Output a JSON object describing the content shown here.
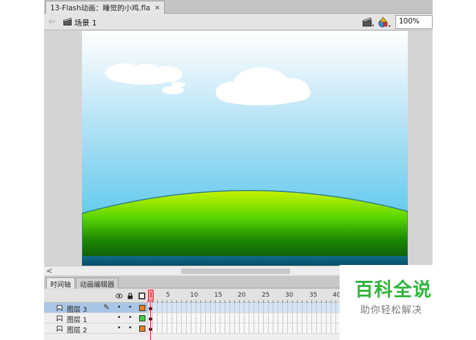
{
  "document": {
    "tab_title": "13-Flash动画：睡觉的小鸡.fla",
    "close_glyph": "×"
  },
  "edit_bar": {
    "back_glyph": "⇦",
    "scene_label": "场景 1",
    "zoom": "100%"
  },
  "scrollbar": {
    "left_arrow": "<"
  },
  "panel_tabs": {
    "timeline": "时间轴",
    "motion_editor": "动画编辑器"
  },
  "timeline": {
    "playhead_frame": "1",
    "ruler_labels": [
      "5",
      "10",
      "15",
      "20",
      "25",
      "30",
      "35",
      "40"
    ],
    "layers": [
      {
        "name": "图层 3",
        "selected": true,
        "editing": true,
        "color": "#ee7d1a"
      },
      {
        "name": "图层 1",
        "selected": false,
        "editing": false,
        "color": "#44cc44"
      },
      {
        "name": "图层 2",
        "selected": false,
        "editing": false,
        "color": "#ee7d1a"
      }
    ],
    "visible_dot": "•",
    "pencil_glyph": "✎"
  },
  "watermark": {
    "title": "百科全说",
    "subtitle": "助你轻松解决"
  },
  "colors": {
    "grass_top": "#b4f000",
    "grass_bottom": "#0a5a00",
    "sea": "#0a6a8a",
    "accent_green": "#2fb53c"
  }
}
